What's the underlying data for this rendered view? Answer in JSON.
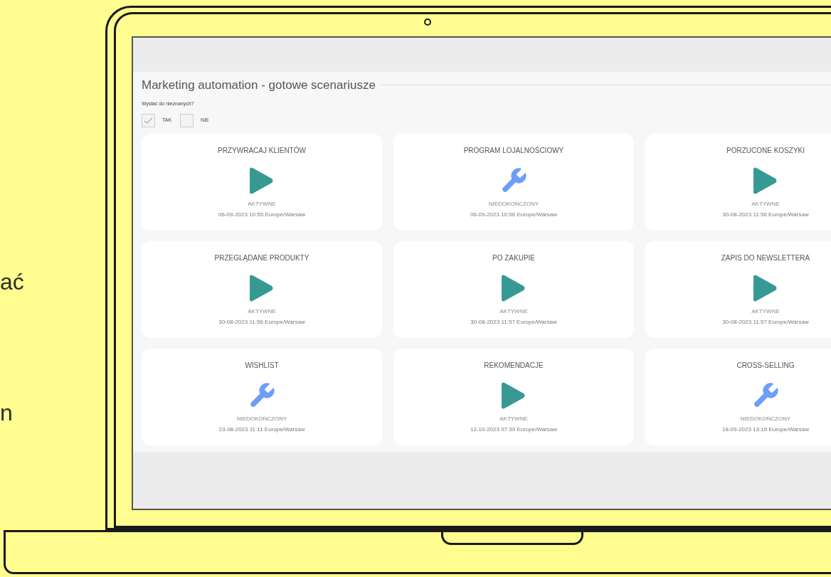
{
  "background_text": [
    "ać",
    "n"
  ],
  "page": {
    "title": "Marketing automation - gotowe scenariusze",
    "question": "Wysłać do nieznanych?",
    "options": [
      {
        "label": "TAK",
        "checked": true
      },
      {
        "label": "NIE",
        "checked": false
      }
    ]
  },
  "scenarios": [
    {
      "title": "PRZYWRACAJ KLIENTÓW",
      "kind": "active",
      "status": "AKTYWNE",
      "date": "06-09-2023 10:55 Europe/Warsaw"
    },
    {
      "title": "PROGRAM LOJALNOŚCIOWY",
      "kind": "unfinished",
      "status": "NIEDOKOŃCZONY",
      "date": "06-09-2023 10:56 Europe/Warsaw"
    },
    {
      "title": "PORZUCONE KOSZYKI",
      "kind": "active",
      "status": "AKTYWNE",
      "date": "30-08-2023 11:56 Europe/Warsaw"
    },
    {
      "title": "PRZEGLĄDANE PRODUKTY",
      "kind": "active",
      "status": "AKTYWNE",
      "date": "30-08-2023 11:56 Europe/Warsaw"
    },
    {
      "title": "PO ZAKUPIE",
      "kind": "active",
      "status": "AKTYWNE",
      "date": "30-08-2023 11:57 Europe/Warsaw"
    },
    {
      "title": "ZAPIS DO NEWSLETTERA",
      "kind": "active",
      "status": "AKTYWNE",
      "date": "30-08-2023 11:57 Europe/Warsaw"
    },
    {
      "title": "WISHLIST",
      "kind": "unfinished",
      "status": "NIEDOKOŃCZONY",
      "date": "23-08-2023 11:11 Europe/Warsaw"
    },
    {
      "title": "REKOMENDACJE",
      "kind": "active",
      "status": "AKTYWNE",
      "date": "12-10-2023 07:39 Europe/Warsaw"
    },
    {
      "title": "CROSS-SELLING",
      "kind": "unfinished",
      "status": "NIEDOKOŃCZONY",
      "date": "18-09-2023 13:15 Europe/Warsaw"
    }
  ]
}
